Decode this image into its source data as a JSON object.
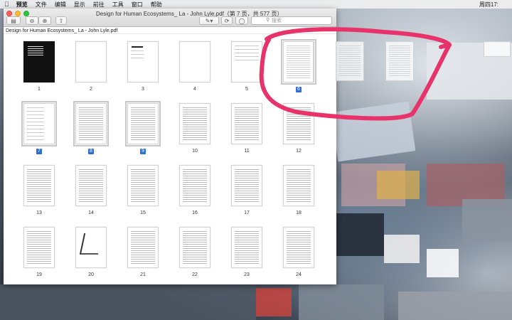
{
  "menubar": {
    "apple": "",
    "items": [
      "预览",
      "文件",
      "编辑",
      "显示",
      "前往",
      "工具",
      "窗口",
      "帮助"
    ],
    "right_text": "周四17:"
  },
  "window": {
    "title": "Design for Human Ecosystems_ La - John Lyle.pdf（第 7 页，共 577 页）",
    "search_placeholder": "搜索",
    "doc_label": "Design for Human Ecosystems_ La - John Lyle.pdf"
  },
  "pages": [
    {
      "num": "1",
      "style": "cover"
    },
    {
      "num": "2",
      "style": "blank"
    },
    {
      "num": "3",
      "style": "title"
    },
    {
      "num": "4",
      "style": "blank"
    },
    {
      "num": "5",
      "style": "text-sparse"
    },
    {
      "num": "6",
      "style": "text",
      "selected": true,
      "badge": true
    },
    {
      "num": "7",
      "style": "toc",
      "selected": true,
      "badge": true
    },
    {
      "num": "8",
      "style": "text",
      "selected": true,
      "badge": true
    },
    {
      "num": "9",
      "style": "text",
      "selected": true,
      "badge": true
    },
    {
      "num": "10",
      "style": "text"
    },
    {
      "num": "11",
      "style": "text"
    },
    {
      "num": "12",
      "style": "text"
    },
    {
      "num": "13",
      "style": "text"
    },
    {
      "num": "14",
      "style": "text"
    },
    {
      "num": "15",
      "style": "text"
    },
    {
      "num": "16",
      "style": "text"
    },
    {
      "num": "17",
      "style": "text"
    },
    {
      "num": "18",
      "style": "text"
    },
    {
      "num": "19",
      "style": "text"
    },
    {
      "num": "20",
      "style": "figure"
    },
    {
      "num": "21",
      "style": "text"
    },
    {
      "num": "22",
      "style": "text"
    },
    {
      "num": "23",
      "style": "text"
    },
    {
      "num": "24",
      "style": "text"
    }
  ],
  "colors": {
    "selection_badge": "#2f6fd3",
    "annotation_stroke": "#e8326a"
  },
  "icons": [
    "sidebar-toggle-icon",
    "zoom-out-icon",
    "zoom-in-icon",
    "share-icon",
    "pen-markup-icon",
    "rotate-icon",
    "annotate-icon",
    "search-icon",
    "apple-icon"
  ]
}
